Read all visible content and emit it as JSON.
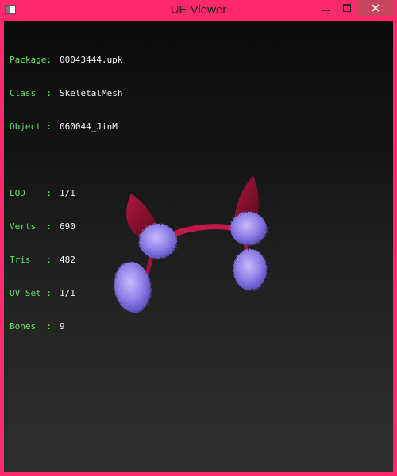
{
  "window": {
    "title": "UE Viewer",
    "accent": "#ff2a6d"
  },
  "controls": {
    "minimize": "minimize-icon",
    "maximize": "maximize-icon",
    "close": "close-icon"
  },
  "info": {
    "package": {
      "key": "Package:",
      "value": "00043444.upk"
    },
    "class": {
      "key": "Class  :",
      "value": "SkeletalMesh"
    },
    "object": {
      "key": "Object :",
      "value": "060044_JinM"
    },
    "lod": {
      "key": "LOD    :",
      "value": "1/1"
    },
    "verts": {
      "key": "Verts  :",
      "value": "690"
    },
    "tris": {
      "key": "Tris   :",
      "value": "482"
    },
    "uvset": {
      "key": "UV Set :",
      "value": "1/1"
    },
    "bones": {
      "key": "Bones  :",
      "value": "9"
    }
  },
  "colors": {
    "label": "#5fe65a",
    "value": "#f2f2f2",
    "axis": "#1a1aa0"
  }
}
